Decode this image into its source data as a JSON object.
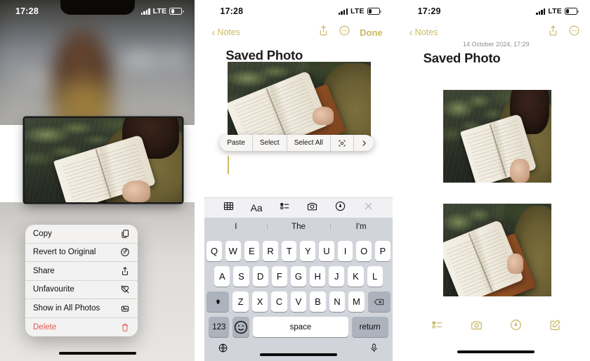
{
  "panels": [
    {
      "id": "photos-context-menu",
      "status": {
        "time": "17:28",
        "network": "LTE",
        "battery_icon": "battery-low"
      },
      "menu": {
        "items": [
          {
            "label": "Copy",
            "icon": "copy-icon"
          },
          {
            "label": "Revert to Original",
            "icon": "revert-icon"
          },
          {
            "label": "Share",
            "icon": "share-icon"
          },
          {
            "label": "Unfavourite",
            "icon": "heart-slash-icon"
          },
          {
            "label": "Show in All Photos",
            "icon": "photos-icon"
          },
          {
            "label": "Delete",
            "icon": "trash-icon"
          }
        ]
      }
    },
    {
      "id": "notes-editing",
      "status": {
        "time": "17:28",
        "network": "LTE",
        "battery_icon": "battery-low"
      },
      "nav": {
        "back_label": "Notes",
        "share_icon": "share-icon",
        "more_icon": "more-circle-icon",
        "done_label": "Done"
      },
      "note_title": "Saved Photo",
      "edit_menu": {
        "items": [
          {
            "label": "Paste"
          },
          {
            "label": "Select"
          },
          {
            "label": "Select All"
          }
        ],
        "scan_icon": "scan-document-icon",
        "more_chevron": "chevron-right-icon"
      },
      "keyboard_toolbar": {
        "icons": [
          "table-icon",
          "format-aa-icon",
          "checklist-icon",
          "camera-icon",
          "markup-pen-icon",
          "close-icon"
        ],
        "aa_label": "Aa"
      },
      "predictions": [
        "I",
        "The",
        "I'm"
      ],
      "keyboard": {
        "row1": [
          "Q",
          "W",
          "E",
          "R",
          "T",
          "Y",
          "U",
          "I",
          "O",
          "P"
        ],
        "row2": [
          "A",
          "S",
          "D",
          "F",
          "G",
          "H",
          "J",
          "K",
          "L"
        ],
        "row3": [
          "Z",
          "X",
          "C",
          "V",
          "B",
          "N",
          "M"
        ],
        "shift_icon": "shift-icon",
        "backspace_icon": "backspace-icon",
        "numbers_label": "123",
        "emoji_icon": "emoji-icon",
        "space_label": "space",
        "return_label": "return",
        "globe_icon": "globe-icon",
        "mic_icon": "microphone-icon"
      }
    },
    {
      "id": "notes-saved",
      "status": {
        "time": "17:29",
        "network": "LTE",
        "battery_icon": "battery-low"
      },
      "nav": {
        "back_label": "Notes",
        "share_icon": "share-icon",
        "more_icon": "more-circle-icon"
      },
      "note_date": "14 October 2024, 17:29",
      "note_title": "Saved Photo",
      "toolbar_icons": [
        "checklist-icon",
        "camera-icon",
        "markup-pen-icon",
        "compose-icon"
      ]
    }
  ],
  "colors": {
    "accent_gold": "#c9ba67",
    "delete_red": "#e2574c",
    "keyboard_bg": "#d1d4da",
    "title_text": "#1d1d1f"
  }
}
